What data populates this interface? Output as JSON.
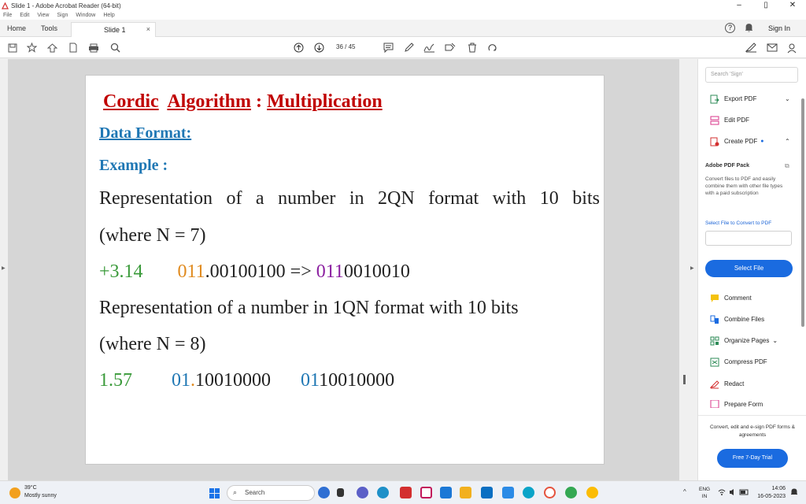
{
  "window": {
    "title": "Slide 1 - Adobe Acrobat Reader (64-bit)",
    "minimize": "–",
    "maximize": "▯",
    "close": "✕"
  },
  "menu": [
    "File",
    "Edit",
    "View",
    "Sign",
    "Window",
    "Help"
  ],
  "tabs": {
    "home": "Home",
    "tools": "Tools",
    "doc": "Slide 1",
    "doc_close": "×",
    "help": "?",
    "sign_in": "Sign In"
  },
  "toolbar": {
    "page_current": "36",
    "page_sep": "/",
    "page_total": "45"
  },
  "slide": {
    "title_part1": "Cordic",
    "title_part2": "Algorithm",
    "title_sep": " : ",
    "title_part3": "Multiplication",
    "data_format": "Data Format:",
    "example": "Example :",
    "line1_words": [
      "Representation",
      "of",
      "a",
      "number",
      "in",
      "2QN",
      "format",
      "with",
      "10",
      "bits"
    ],
    "line2": "(where N = 7)",
    "line3": {
      "value": "+3.14",
      "bin_a": "011",
      "bin_b": ".00100100",
      "arrow": " => ",
      "bin_c": "011",
      "bin_d": "0010010"
    },
    "line4": "Representation of a number in 1QN format with 10 bits",
    "line5": "(where N = 8)",
    "line6": {
      "value": "1.57",
      "bin_a": "01",
      "bin_b": ".",
      "bin_c": "10010000",
      "bin_d": "01",
      "bin_e": "10010000"
    }
  },
  "right_panel": {
    "search_placeholder": "Search 'Sign'",
    "export_pdf": "Export PDF",
    "edit_pdf": "Edit PDF",
    "create_pdf": "Create PDF",
    "pack_title": "Adobe PDF Pack",
    "pack_desc": "Convert files to PDF and easily combine them with other file types with a paid subscription",
    "select_label": "Select File to Convert to PDF",
    "select_button": "Select File",
    "comment": "Comment",
    "combine_files": "Combine Files",
    "organize_pages": "Organize Pages",
    "compress_pdf": "Compress PDF",
    "redact": "Redact",
    "prepare_form": "Prepare Form",
    "footer_text": "Convert, edit and e-sign PDF forms & agreements",
    "trial_button": "Free 7-Day Trial"
  },
  "taskbar": {
    "temp": "39°C",
    "weather": "Mostly sunny",
    "search": "Search",
    "lang1": "ENG",
    "lang2": "IN",
    "time": "14:06",
    "date": "16-05-2023"
  },
  "colors": {
    "title_red": "#c00000",
    "heading_blue": "#1f77b4",
    "green": "#3a9a3a",
    "orange": "#e08a1e",
    "purple": "#8b1fa0",
    "accent_blue": "#1a6be0"
  }
}
